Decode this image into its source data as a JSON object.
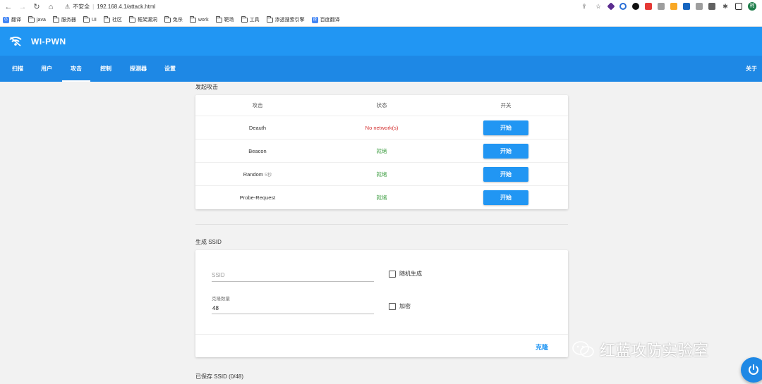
{
  "browser": {
    "security_text": "不安全",
    "url": "192.168.4.1/attack.html",
    "profile_initial": "柯",
    "bookmarks": [
      "翻译",
      "java",
      "服务器",
      "UI",
      "社区",
      "框架漏洞",
      "免杀",
      "work",
      "靶场",
      "工具",
      "渗透搜索引擎",
      "百度翻译"
    ]
  },
  "app": {
    "title": "WI-PWN",
    "tabs": [
      "扫描",
      "用户",
      "攻击",
      "控制",
      "探测器",
      "设置"
    ],
    "about": "关于"
  },
  "attack_section": {
    "label": "发起攻击",
    "headers": [
      "攻击",
      "状态",
      "开关"
    ],
    "rows": [
      {
        "name": "Deauth",
        "extra": "",
        "status": "No network(s)",
        "button": "开始"
      },
      {
        "name": "Beacon",
        "extra": "",
        "status": "就绪",
        "button": "开始"
      },
      {
        "name": "Random",
        "extra": "5秒",
        "status": "就绪",
        "button": "开始"
      },
      {
        "name": "Probe-Request",
        "extra": "",
        "status": "就绪",
        "button": "开始"
      }
    ]
  },
  "ssid_section": {
    "label": "生成 SSID",
    "ssid_placeholder": "SSID",
    "clone_count_label": "克隆数量",
    "clone_count_value": "48",
    "random_label": "随机生成",
    "encrypt_label": "加密",
    "clone_button": "克隆"
  },
  "saved_section": {
    "label": "已保存 SSID (0/48)"
  },
  "watermark": {
    "text": "红蓝攻防实验室"
  },
  "colors": {
    "primary": "#2196f3",
    "nav": "#1e88e5",
    "error": "#d32f2f",
    "ready": "#43a047"
  }
}
